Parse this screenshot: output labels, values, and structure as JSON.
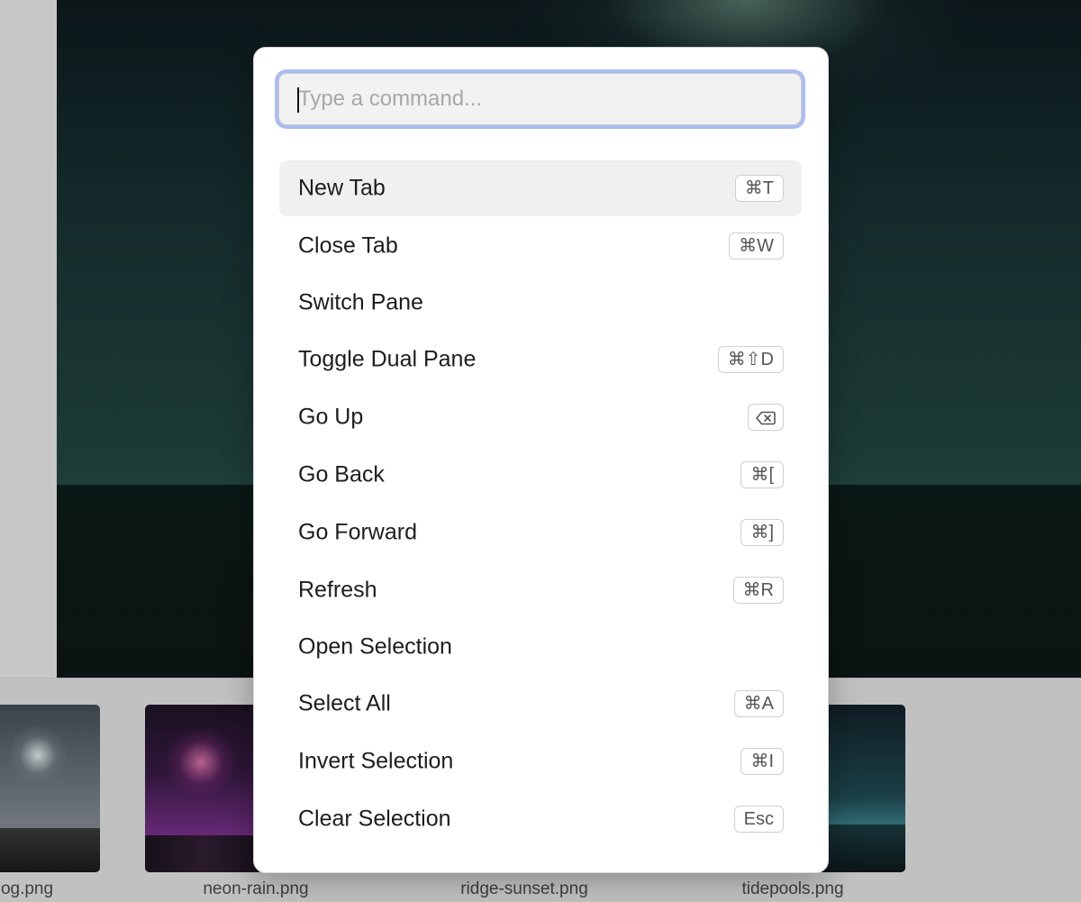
{
  "palette": {
    "search": {
      "placeholder": "Type a command..."
    },
    "items": [
      {
        "label": "New Tab",
        "shortcut": "⌘T",
        "active": true
      },
      {
        "label": "Close Tab",
        "shortcut": "⌘W"
      },
      {
        "label": "Switch Pane",
        "shortcut": ""
      },
      {
        "label": "Toggle Dual Pane",
        "shortcut": "⌘⇧D"
      },
      {
        "label": "Go Up",
        "shortcut_icon": "delete-backward-icon"
      },
      {
        "label": "Go Back",
        "shortcut": "⌘["
      },
      {
        "label": "Go Forward",
        "shortcut": "⌘]"
      },
      {
        "label": "Refresh",
        "shortcut": "⌘R"
      },
      {
        "label": "Open Selection",
        "shortcut": ""
      },
      {
        "label": "Select All",
        "shortcut": "⌘A"
      },
      {
        "label": "Invert Selection",
        "shortcut": "⌘I"
      },
      {
        "label": "Clear Selection",
        "shortcut": "Esc"
      }
    ]
  },
  "filmstrip": {
    "files": [
      {
        "name": "og.png"
      },
      {
        "name": "neon-rain.png"
      },
      {
        "name": "ridge-sunset.png"
      },
      {
        "name": "tidepools.png"
      }
    ]
  },
  "colors": {
    "focus_ring": "#a9bdf3",
    "active_row": "#f0f0f0"
  }
}
